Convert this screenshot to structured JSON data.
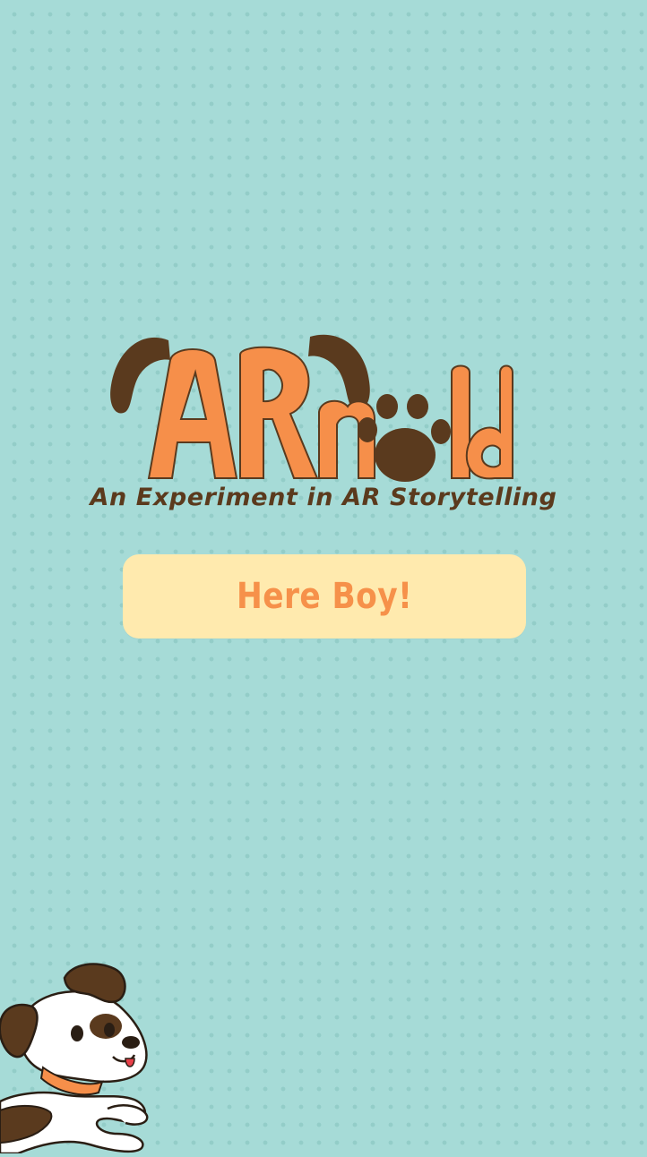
{
  "app": {
    "logo_text": "ARnold",
    "tagline": "An Experiment in AR Storytelling"
  },
  "actions": {
    "start_label": "Here Boy!"
  },
  "colors": {
    "background": "#a6dbd7",
    "background_dots": "#93cdc8",
    "logo_orange": "#f68f4a",
    "logo_brown": "#5a3a1e",
    "button_background": "#ffeaae",
    "button_text": "#f6914a",
    "tagline": "#5b3a1d"
  },
  "icons": {
    "paw": "paw-print-icon",
    "mascot": "dog-mascot"
  }
}
